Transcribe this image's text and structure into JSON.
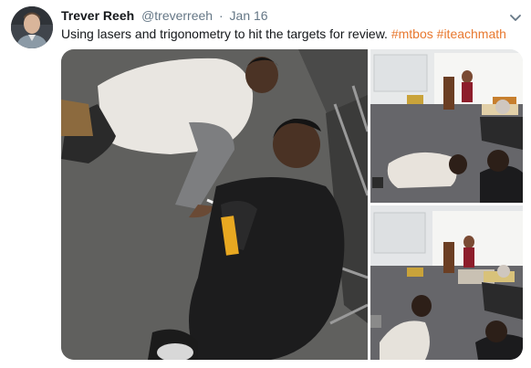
{
  "author": {
    "name": "Trever Reeh",
    "handle": "@treverreeh",
    "separator": "·",
    "date": "Jan 16"
  },
  "tweet": {
    "text": "Using lasers and trigonometry to hit the targets for review.",
    "hashtags": [
      "#mtbos",
      "#iteachmath"
    ]
  },
  "icons": {
    "more": "chevron-down-icon",
    "avatar": "profile-photo"
  },
  "colors": {
    "hashtag": "#e8782f",
    "secondary_text": "#657786",
    "primary_text": "#14171a"
  },
  "media": {
    "photo_count": 3
  }
}
